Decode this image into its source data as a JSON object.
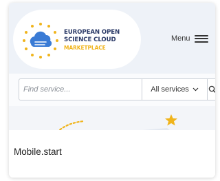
{
  "brand": {
    "line1": "EUROPEAN OPEN",
    "line2": "SCIENCE CLOUD",
    "line3": "MARKETPLACE",
    "colors": {
      "navy": "#2b3a67",
      "gold": "#f0b41c",
      "blue": "#3a7bd5"
    }
  },
  "header": {
    "menu_label": "Menu",
    "menu_icon": "hamburger-icon"
  },
  "search": {
    "placeholder": "Find service...",
    "value": "",
    "category_selected": "All services",
    "category_icon": "chevron-down-icon",
    "button_icon": "search-icon"
  },
  "hero": {
    "decoration_icon": "star-icon"
  },
  "caption": {
    "text": "Mobile.start"
  }
}
